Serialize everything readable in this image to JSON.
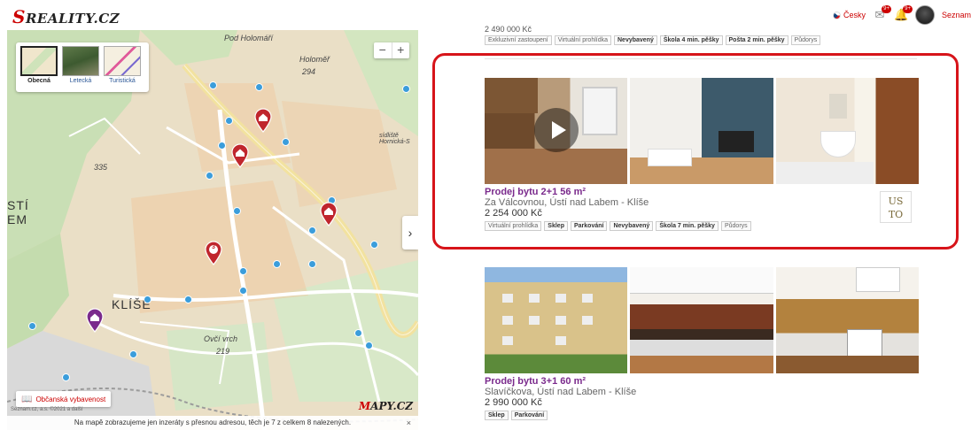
{
  "header": {
    "logo_text": "REALITY.CZ",
    "logo_initial": "S",
    "lang_label": "Česky",
    "mail_badge": "9+",
    "bell_badge": "9+",
    "seznam_label": "Seznam"
  },
  "map": {
    "layers": [
      {
        "label": "Obecná",
        "active": true
      },
      {
        "label": "Letecká",
        "active": false
      },
      {
        "label": "Turistická",
        "active": false
      }
    ],
    "zoom_out": "−",
    "zoom_in": "+",
    "expand_arrow": "›",
    "places": [
      {
        "label": "Pod Holomáří"
      },
      {
        "label": "Holoměř"
      },
      {
        "label": "294"
      },
      {
        "label": "335"
      },
      {
        "label": "STÍ"
      },
      {
        "label": "EM"
      },
      {
        "label": "KLÍŠE"
      },
      {
        "label": "Ovčí vrch"
      },
      {
        "label": "219"
      },
      {
        "label": "sídliště Hornická-S"
      }
    ],
    "cluster_count": "3",
    "amenity_label": "Občanská vybavenost",
    "brand": "APY.CZ",
    "brand_initial": "M",
    "copyright": "Seznam.cz, a.s. ©2021 a další",
    "note": "Na mapě zobrazujeme jen inzeráty s přesnou adresou, těch je 7 z celkem 8 nalezených.",
    "note_close": "×"
  },
  "listings": {
    "previous_price": "2 490 000 Kč",
    "previous_tags": [
      {
        "label": "Exkluzivní zastoupení",
        "bold": false
      },
      {
        "label": "Virtuální prohlídka",
        "bold": false
      },
      {
        "label": "Nevybavený",
        "bold": true
      },
      {
        "label": "Škola 4 min. pěšky",
        "bold": true
      },
      {
        "label": "Pošta 2 min. pěšky",
        "bold": true
      },
      {
        "label": "Půdorys",
        "bold": false
      }
    ],
    "cards": [
      {
        "title": "Prodej bytu 2+1 56 m²",
        "address": "Za Válcovnou, Ústí nad Labem - Klíše",
        "price": "2 254 000 Kč",
        "agency": "JUSTO",
        "agency_line1": "US",
        "agency_line2": "TO",
        "tags": [
          {
            "label": "Virtuální prohlídka",
            "bold": false
          },
          {
            "label": "Sklep",
            "bold": true
          },
          {
            "label": "Parkování",
            "bold": true
          },
          {
            "label": "Nevybavený",
            "bold": true
          },
          {
            "label": "Škola 7 min. pěšky",
            "bold": true
          },
          {
            "label": "Půdorys",
            "bold": false
          }
        ]
      },
      {
        "title": "Prodej bytu 3+1 60 m²",
        "address": "Slavíčkova, Ústí nad Labem - Klíše",
        "price": "2 990 000 Kč",
        "tags": [
          {
            "label": "Sklep",
            "bold": true
          },
          {
            "label": "Parkování",
            "bold": true
          }
        ]
      }
    ]
  },
  "colors": {
    "brand_red": "#cc0000",
    "highlight_red": "#d7141a",
    "title_purple": "#7a2a8c",
    "map_bg": "#e8dcc0",
    "bus_stop_blue": "#3b9ddb"
  }
}
